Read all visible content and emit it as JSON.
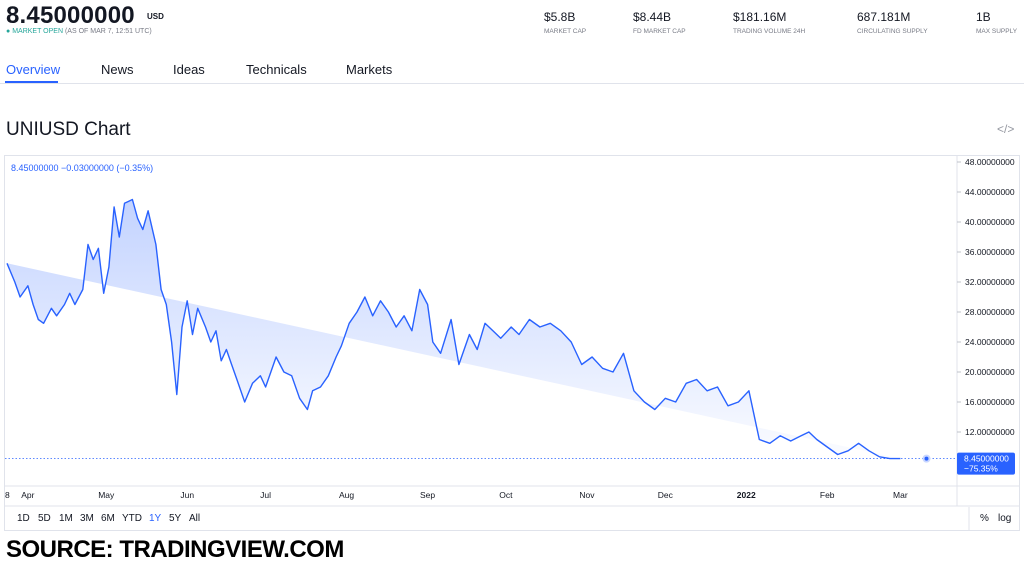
{
  "header": {
    "price": "8.45000000",
    "currency": "USD",
    "status_dot": "●",
    "status_open": "MARKET OPEN",
    "status_time": "(AS OF MAR 7, 12:51 UTC)"
  },
  "stats": [
    {
      "value": "$5.8B",
      "label": "MARKET CAP"
    },
    {
      "value": "$8.44B",
      "label": "FD MARKET CAP"
    },
    {
      "value": "$181.16M",
      "label": "TRADING VOLUME 24H"
    },
    {
      "value": "687.181M",
      "label": "CIRCULATING SUPPLY"
    },
    {
      "value": "1B",
      "label": "MAX SUPPLY"
    }
  ],
  "tabs": [
    "Overview",
    "News",
    "Ideas",
    "Technicals",
    "Markets"
  ],
  "chart_title": "UNIUSD Chart",
  "embed_icon": "</>",
  "chart_data": {
    "type": "area",
    "title": "UNIUSD Chart",
    "legend_text": "8.45000000 −0.03000000 (−0.35%)",
    "y_ticks": [
      "48.00000000",
      "44.00000000",
      "40.00000000",
      "36.00000000",
      "32.00000000",
      "28.00000000",
      "24.00000000",
      "20.00000000",
      "16.00000000",
      "12.00000000"
    ],
    "y_tick_values": [
      48,
      44,
      40,
      36,
      32,
      28,
      24,
      20,
      16,
      12
    ],
    "ylim": [
      6.5,
      48
    ],
    "x_ticks": [
      "8",
      "Apr",
      "May",
      "Jun",
      "Jul",
      "Aug",
      "Sep",
      "Oct",
      "Nov",
      "Dec",
      "2022",
      "Feb",
      "Mar"
    ],
    "x_tick_days": [
      0,
      8,
      38,
      69,
      99,
      130,
      161,
      191,
      222,
      252,
      283,
      314,
      342
    ],
    "xlim": [
      0,
      361
    ],
    "current_value": 8.45,
    "current_label": "8.45000000",
    "current_change": "−75.35%",
    "line_color": "#2962ff",
    "x_days": [
      0,
      3,
      5,
      8,
      10,
      12,
      14,
      17,
      19,
      22,
      24,
      26,
      29,
      31,
      33,
      35,
      37,
      39,
      41,
      43,
      45,
      48,
      50,
      52,
      54,
      57,
      59,
      61,
      63,
      65,
      67,
      69,
      71,
      73,
      76,
      78,
      80,
      82,
      84,
      86,
      88,
      91,
      94,
      97,
      99,
      103,
      106,
      109,
      112,
      115,
      117,
      120,
      123,
      126,
      128,
      131,
      134,
      137,
      140,
      143,
      146,
      149,
      152,
      155,
      158,
      161,
      163,
      166,
      170,
      173,
      177,
      180,
      183,
      186,
      189,
      193,
      196,
      200,
      204,
      208,
      212,
      216,
      220,
      224,
      228,
      232,
      236,
      240,
      244,
      248,
      252,
      256,
      260,
      264,
      268,
      272,
      276,
      280,
      284,
      288,
      292,
      296,
      300,
      304,
      307,
      310,
      314,
      318,
      322,
      326,
      330,
      334,
      338,
      342,
      346,
      348,
      350,
      352
    ],
    "values": [
      34.5,
      32.0,
      30.0,
      31.5,
      29.0,
      27.0,
      26.5,
      28.5,
      27.5,
      29.0,
      30.5,
      29.0,
      31.0,
      37.0,
      35.0,
      36.5,
      30.5,
      34.0,
      42.0,
      38.0,
      42.5,
      43.0,
      40.5,
      39.0,
      41.5,
      37.0,
      31.0,
      29.0,
      24.0,
      17.0,
      26.0,
      29.5,
      25.0,
      28.5,
      26.0,
      24.0,
      25.5,
      21.5,
      23.0,
      21.0,
      19.0,
      16.0,
      18.5,
      19.5,
      18.0,
      22.0,
      20.0,
      19.5,
      16.5,
      15.0,
      17.5,
      18.0,
      19.5,
      22.0,
      23.5,
      26.5,
      28.0,
      30.0,
      27.5,
      29.5,
      28.0,
      26.0,
      27.5,
      25.5,
      31.0,
      29.0,
      24.0,
      22.5,
      27.0,
      21.0,
      25.0,
      23.0,
      26.5,
      25.5,
      24.5,
      26.0,
      25.0,
      27.0,
      26.0,
      26.5,
      25.5,
      24.0,
      21.0,
      22.0,
      20.5,
      20.0,
      22.5,
      17.5,
      16.0,
      15.0,
      16.5,
      16.0,
      18.5,
      19.0,
      17.5,
      18.0,
      15.5,
      16.0,
      17.5,
      11.0,
      10.5,
      11.5,
      10.8,
      11.5,
      12.0,
      11.0,
      10.0,
      9.0,
      9.5,
      10.5,
      9.5,
      8.7,
      8.45,
      8.45
    ]
  },
  "range_buttons": [
    "1D",
    "5D",
    "1M",
    "3M",
    "6M",
    "YTD",
    "1Y",
    "5Y",
    "All"
  ],
  "selected_range": "1Y",
  "scale_buttons": [
    "%",
    "log"
  ],
  "source_text": "SOURCE: TRADINGVIEW.COM"
}
